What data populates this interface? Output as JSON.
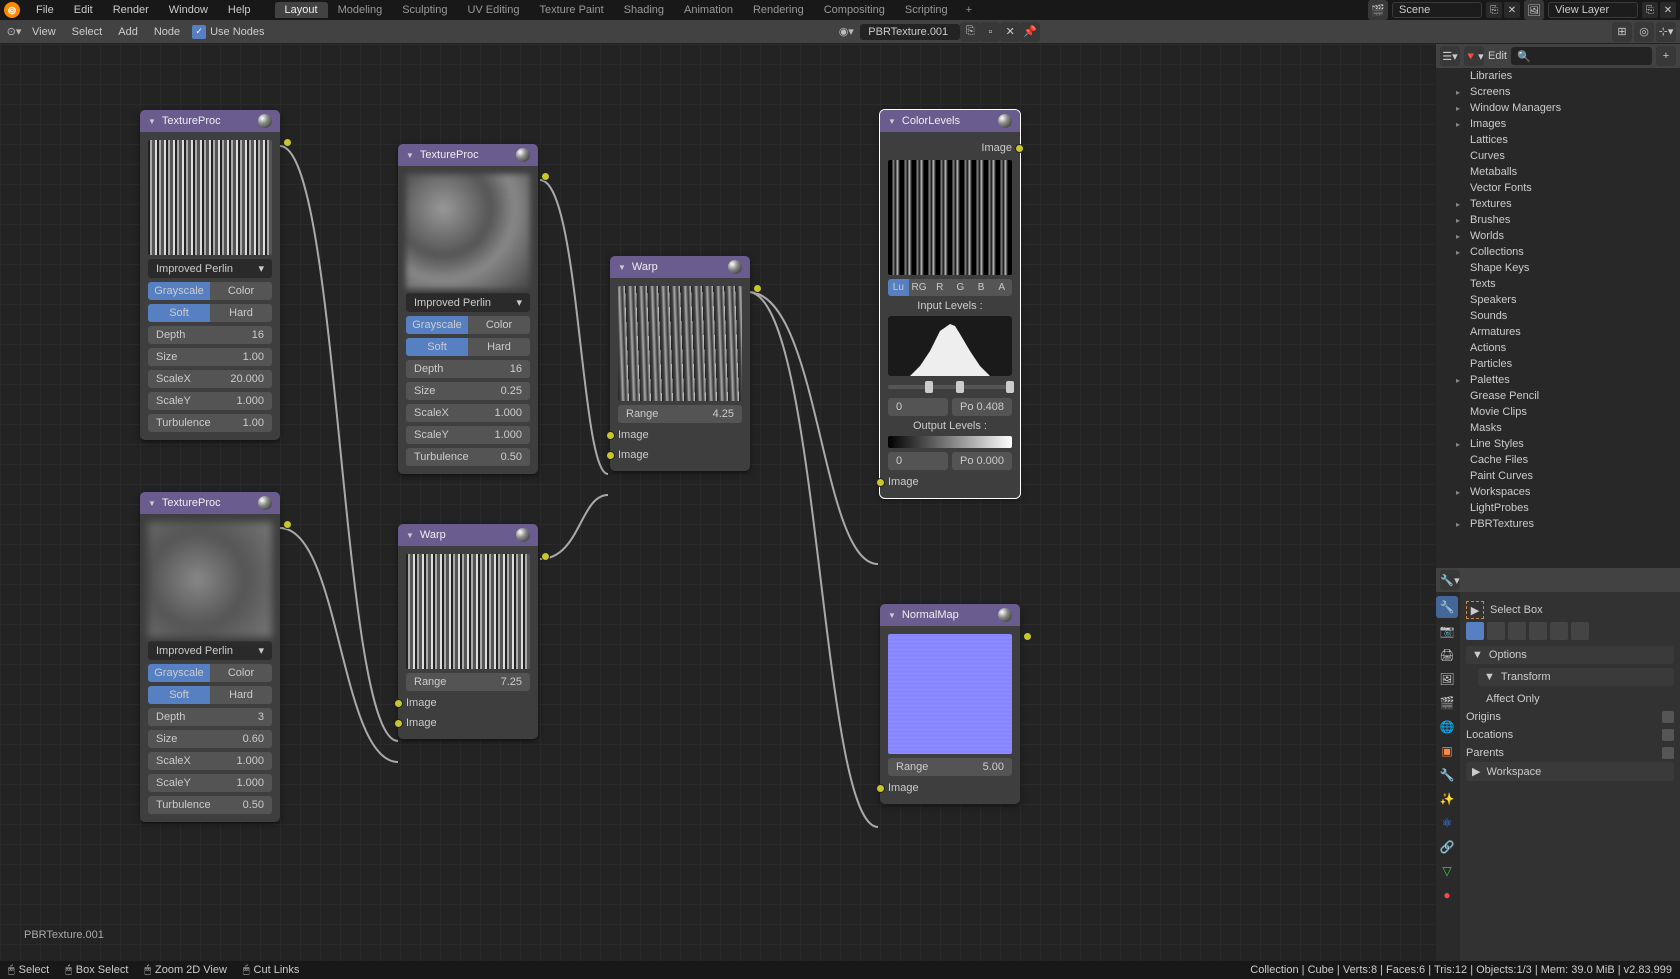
{
  "topMenu": [
    "File",
    "Edit",
    "Render",
    "Window",
    "Help"
  ],
  "tabs": [
    "Layout",
    "Modeling",
    "Sculpting",
    "UV Editing",
    "Texture Paint",
    "Shading",
    "Animation",
    "Rendering",
    "Compositing",
    "Scripting"
  ],
  "activeTab": 0,
  "sceneLabel": "Scene",
  "viewLayerLabel": "View Layer",
  "secondBar": {
    "items": [
      "View",
      "Select",
      "Add",
      "Node"
    ],
    "useNodesLabel": "Use Nodes",
    "materialName": "PBRTexture.001"
  },
  "outlinerEdit": "Edit",
  "outliner": [
    {
      "label": "Libraries",
      "exp": false,
      "indent": 0,
      "tri": "none"
    },
    {
      "label": "Screens",
      "exp": true,
      "indent": 0,
      "tri": "right"
    },
    {
      "label": "Window Managers",
      "exp": true,
      "indent": 0,
      "tri": "right"
    },
    {
      "label": "Images",
      "exp": true,
      "indent": 0,
      "tri": "right"
    },
    {
      "label": "Lattices",
      "exp": false,
      "indent": 0,
      "tri": "none"
    },
    {
      "label": "Curves",
      "exp": false,
      "indent": 0,
      "tri": "none"
    },
    {
      "label": "Metaballs",
      "exp": false,
      "indent": 0,
      "tri": "none"
    },
    {
      "label": "Vector Fonts",
      "exp": false,
      "indent": 0,
      "tri": "none"
    },
    {
      "label": "Textures",
      "exp": true,
      "indent": 0,
      "tri": "right"
    },
    {
      "label": "Brushes",
      "exp": true,
      "indent": 0,
      "tri": "right"
    },
    {
      "label": "Worlds",
      "exp": true,
      "indent": 0,
      "tri": "right"
    },
    {
      "label": "Collections",
      "exp": true,
      "indent": 0,
      "tri": "right"
    },
    {
      "label": "Shape Keys",
      "exp": false,
      "indent": 0,
      "tri": "none"
    },
    {
      "label": "Texts",
      "exp": false,
      "indent": 0,
      "tri": "none"
    },
    {
      "label": "Speakers",
      "exp": false,
      "indent": 0,
      "tri": "none"
    },
    {
      "label": "Sounds",
      "exp": false,
      "indent": 0,
      "tri": "none"
    },
    {
      "label": "Armatures",
      "exp": false,
      "indent": 0,
      "tri": "none"
    },
    {
      "label": "Actions",
      "exp": false,
      "indent": 0,
      "tri": "none"
    },
    {
      "label": "Particles",
      "exp": false,
      "indent": 0,
      "tri": "none"
    },
    {
      "label": "Palettes",
      "exp": true,
      "indent": 0,
      "tri": "right"
    },
    {
      "label": "Grease Pencil",
      "exp": false,
      "indent": 0,
      "tri": "none"
    },
    {
      "label": "Movie Clips",
      "exp": false,
      "indent": 0,
      "tri": "none"
    },
    {
      "label": "Masks",
      "exp": false,
      "indent": 0,
      "tri": "none"
    },
    {
      "label": "Line Styles",
      "exp": true,
      "indent": 0,
      "tri": "right"
    },
    {
      "label": "Cache Files",
      "exp": false,
      "indent": 0,
      "tri": "none"
    },
    {
      "label": "Paint Curves",
      "exp": false,
      "indent": 0,
      "tri": "none"
    },
    {
      "label": "Workspaces",
      "exp": true,
      "indent": 0,
      "tri": "right"
    },
    {
      "label": "LightProbes",
      "exp": false,
      "indent": 0,
      "tri": "none"
    },
    {
      "label": "PBRTextures",
      "exp": true,
      "indent": 0,
      "tri": "right"
    }
  ],
  "breadcrumb": "PBRTexture.001",
  "properties": {
    "toolName": "Select Box",
    "optionsLabel": "Options",
    "transformLabel": "Transform",
    "affectOnlyLabel": "Affect Only",
    "originsLabel": "Origins",
    "locationsLabel": "Locations",
    "parentsLabel": "Parents",
    "workspaceLabel": "Workspace"
  },
  "nodes": {
    "tex1": {
      "title": "TextureProc",
      "noise": "Improved Perlin",
      "gray": "Grayscale",
      "color": "Color",
      "soft": "Soft",
      "hard": "Hard",
      "depth": {
        "k": "Depth",
        "v": "16"
      },
      "size": {
        "k": "Size",
        "v": "1.00"
      },
      "sx": {
        "k": "ScaleX",
        "v": "20.000"
      },
      "sy": {
        "k": "ScaleY",
        "v": "1.000"
      },
      "turb": {
        "k": "Turbulence",
        "v": "1.00"
      }
    },
    "tex2": {
      "title": "TextureProc",
      "noise": "Improved Perlin",
      "gray": "Grayscale",
      "color": "Color",
      "soft": "Soft",
      "hard": "Hard",
      "depth": {
        "k": "Depth",
        "v": "16"
      },
      "size": {
        "k": "Size",
        "v": "0.25"
      },
      "sx": {
        "k": "ScaleX",
        "v": "1.000"
      },
      "sy": {
        "k": "ScaleY",
        "v": "1.000"
      },
      "turb": {
        "k": "Turbulence",
        "v": "0.50"
      }
    },
    "tex3": {
      "title": "TextureProc",
      "noise": "Improved Perlin",
      "gray": "Grayscale",
      "color": "Color",
      "soft": "Soft",
      "hard": "Hard",
      "depth": {
        "k": "Depth",
        "v": "3"
      },
      "size": {
        "k": "Size",
        "v": "0.60"
      },
      "sx": {
        "k": "ScaleX",
        "v": "1.000"
      },
      "sy": {
        "k": "ScaleY",
        "v": "1.000"
      },
      "turb": {
        "k": "Turbulence",
        "v": "0.50"
      }
    },
    "warp1": {
      "title": "Warp",
      "range": {
        "k": "Range",
        "v": "7.25"
      },
      "img": "Image"
    },
    "warp2": {
      "title": "Warp",
      "range": {
        "k": "Range",
        "v": "4.25"
      },
      "img": "Image"
    },
    "color": {
      "title": "ColorLevels",
      "outImg": "Image",
      "ch": [
        "Lu",
        "RG",
        "R",
        "G",
        "B",
        "A"
      ],
      "inLevels": "Input Levels :",
      "outLevels": "Output Levels :",
      "in0": "0",
      "inPo": "Po",
      "inPoV": "0.408",
      "out0": "0",
      "outPo": "Po",
      "outPoV": "0.000",
      "inImg": "Image"
    },
    "normal": {
      "title": "NormalMap",
      "range": {
        "k": "Range",
        "v": "5.00"
      },
      "img": "Image"
    }
  },
  "status": {
    "select": "Select",
    "box": "Box Select",
    "zoom": "Zoom 2D View",
    "cut": "Cut Links",
    "right": "Collection | Cube | Verts:8 | Faces:6 | Tris:12 | Objects:1/3 | Mem: 39.0 MiB | v2.83.999"
  }
}
